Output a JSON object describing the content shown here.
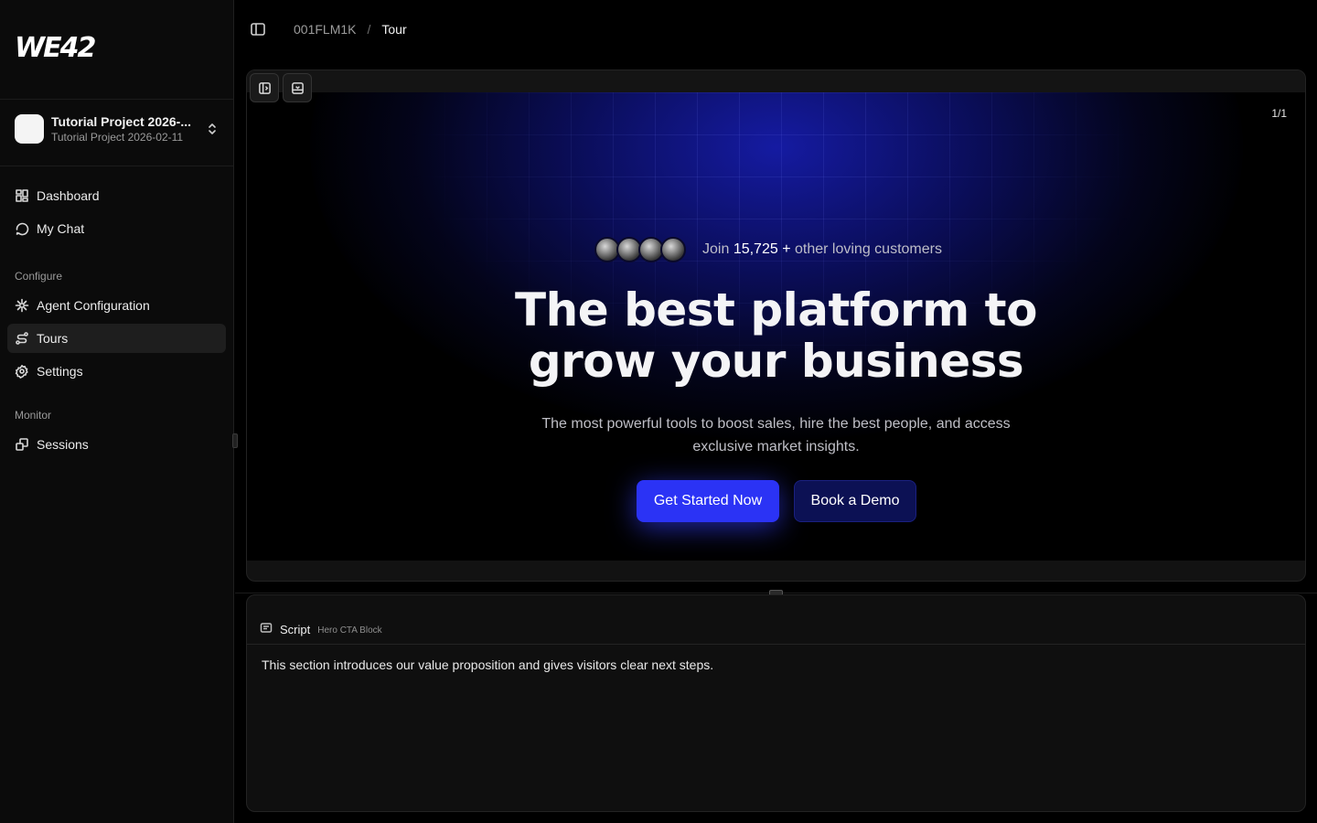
{
  "sidebar": {
    "logo_text": "WE42",
    "project": {
      "name": "Tutorial Project 2026-...",
      "subtitle": "Tutorial Project 2026-02-11"
    },
    "items": [
      {
        "label": "Dashboard",
        "icon": "dashboard-icon"
      },
      {
        "label": "My Chat",
        "icon": "chat-icon"
      }
    ],
    "configure": {
      "heading": "Configure",
      "items": [
        {
          "label": "Agent Configuration",
          "icon": "agent-icon"
        },
        {
          "label": "Tours",
          "icon": "route-icon",
          "active": true
        },
        {
          "label": "Settings",
          "icon": "gear-icon"
        }
      ]
    },
    "monitor": {
      "heading": "Monitor",
      "items": [
        {
          "label": "Sessions",
          "icon": "sessions-icon"
        }
      ]
    }
  },
  "topbar": {
    "breadcrumb": {
      "parent": "001FLM1K",
      "separator": "/",
      "current": "Tour"
    }
  },
  "preview": {
    "page_counter": "1/1",
    "social": {
      "prefix": "Join",
      "count": "15,725 +",
      "suffix": "other loving customers"
    },
    "hero_title": "The best platform to grow your business",
    "hero_subtitle": "The most powerful tools to boost sales, hire the best people, and access exclusive market insights.",
    "cta_primary": "Get Started Now",
    "cta_secondary": "Book a Demo"
  },
  "script": {
    "title": "Script",
    "tag": "Hero CTA Block",
    "body": "This section introduces our value proposition and gives visitors clear next steps."
  },
  "colors": {
    "accent": "#2b33f5",
    "secondary_button": "#0c1154",
    "background": "#000000",
    "sidebar": "#0b0b0b"
  }
}
